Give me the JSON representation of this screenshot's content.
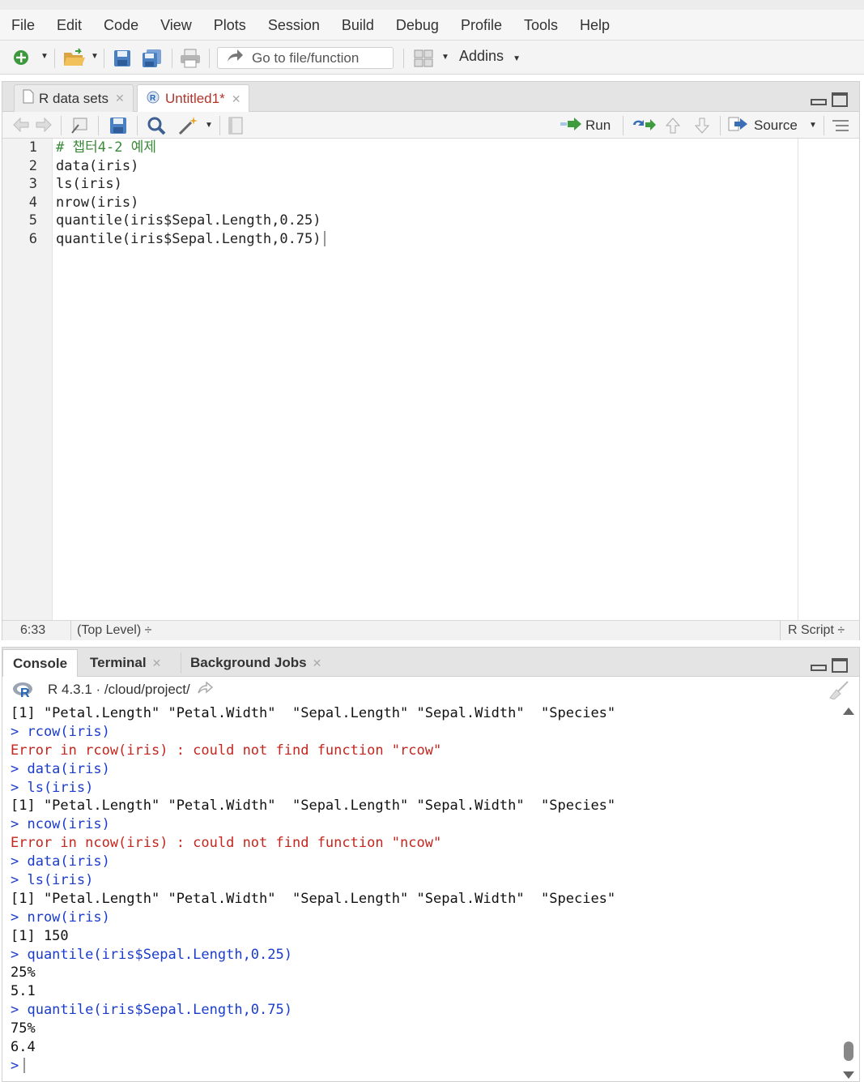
{
  "menu": [
    "File",
    "Edit",
    "Code",
    "View",
    "Plots",
    "Session",
    "Build",
    "Debug",
    "Profile",
    "Tools",
    "Help"
  ],
  "toolbar": {
    "goto_placeholder": "Go to file/function",
    "addins_label": "Addins"
  },
  "editor": {
    "tabs": [
      {
        "label": "R data sets",
        "modified": false
      },
      {
        "label": "Untitled1*",
        "modified": true
      }
    ],
    "run_label": "Run",
    "source_label": "Source",
    "lines": [
      "# 챕터4-2 예제",
      "data(iris)",
      "ls(iris)",
      "nrow(iris)",
      "quantile(iris$Sepal.Length,0.25)",
      "quantile(iris$Sepal.Length,0.75)"
    ],
    "line_numbers": [
      "1",
      "2",
      "3",
      "4",
      "5",
      "6"
    ],
    "status": {
      "position": "6:33",
      "scope": "(Top Level) ÷",
      "file_type": "R Script ÷"
    }
  },
  "console": {
    "tabs": [
      "Console",
      "Terminal",
      "Background Jobs"
    ],
    "version_label": "R 4.3.1 · /cloud/project/",
    "lines": [
      {
        "type": "out",
        "text": "[1] \"Petal.Length\" \"Petal.Width\"  \"Sepal.Length\" \"Sepal.Width\"  \"Species\""
      },
      {
        "type": "cmd",
        "text": "> rcow(iris)"
      },
      {
        "type": "err",
        "text": "Error in rcow(iris) : could not find function \"rcow\""
      },
      {
        "type": "cmd",
        "text": "> data(iris)"
      },
      {
        "type": "cmd",
        "text": "> ls(iris)"
      },
      {
        "type": "out",
        "text": "[1] \"Petal.Length\" \"Petal.Width\"  \"Sepal.Length\" \"Sepal.Width\"  \"Species\""
      },
      {
        "type": "cmd",
        "text": "> ncow(iris)"
      },
      {
        "type": "err",
        "text": "Error in ncow(iris) : could not find function \"ncow\""
      },
      {
        "type": "cmd",
        "text": "> data(iris)"
      },
      {
        "type": "cmd",
        "text": "> ls(iris)"
      },
      {
        "type": "out",
        "text": "[1] \"Petal.Length\" \"Petal.Width\"  \"Sepal.Length\" \"Sepal.Width\"  \"Species\""
      },
      {
        "type": "cmd",
        "text": "> nrow(iris)"
      },
      {
        "type": "out",
        "text": "[1] 150"
      },
      {
        "type": "cmd",
        "text": "> quantile(iris$Sepal.Length,0.25)"
      },
      {
        "type": "out",
        "text": "25%"
      },
      {
        "type": "out",
        "text": "5.1"
      },
      {
        "type": "cmd",
        "text": "> quantile(iris$Sepal.Length,0.75)"
      },
      {
        "type": "out",
        "text": "75%"
      },
      {
        "type": "out",
        "text": "6.4"
      }
    ],
    "prompt": ">"
  },
  "colors": {
    "command_blue": "#1a3ccc",
    "error_red": "#c4261e",
    "comment_green": "#3a8a3a",
    "modified_tab_red": "#b2352c"
  },
  "icons": [
    "new-file-icon",
    "open-folder-icon",
    "save-icon",
    "save-all-icon",
    "print-icon",
    "goto-arrow-icon",
    "grid-layout-icon",
    "back-icon",
    "forward-icon",
    "show-in-window-icon",
    "search-icon",
    "magic-wand-icon",
    "compile-notebook-icon",
    "run-arrow-icon",
    "rerun-icon",
    "up-arrow-icon",
    "down-arrow-icon",
    "source-icon",
    "outline-icon",
    "r-logo-icon",
    "clear-console-icon"
  ]
}
